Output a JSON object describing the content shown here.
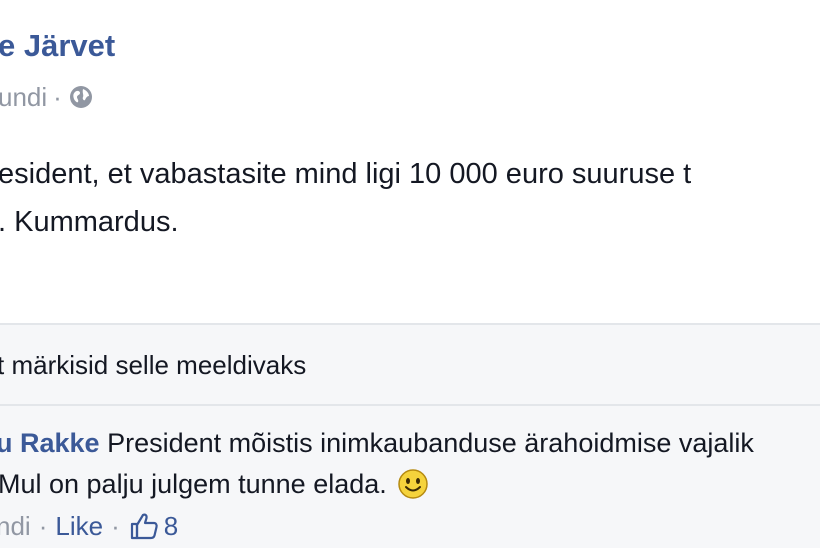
{
  "post": {
    "author": "e Järvet",
    "timestamp": "undi",
    "meta_separator": "·",
    "privacy_icon": "globe-icon",
    "text_line1": "esident, et vabastasite mind ligi 10 000 euro suuruse t",
    "text_line2": ". Kummardus."
  },
  "likes": {
    "text": "t märkisid selle meeldivaks"
  },
  "comment": {
    "author": "u Rakke",
    "text_line1": "President mõistis inimkaubanduse ärahoidmise vajalik",
    "text_line2": "Mul on palju julgem tunne elada.",
    "emoji_icon": "smiley-emoji-icon",
    "timestamp": "ndi",
    "separator": "·",
    "like_label": "Like",
    "like_icon": "thumbs-up-icon",
    "like_count": "8"
  },
  "colors": {
    "link_blue": "#3b5998",
    "meta_gray": "#9197a3",
    "text_dark": "#141823",
    "panel_bg": "#f6f7f9",
    "divider": "#e3e6ea"
  }
}
